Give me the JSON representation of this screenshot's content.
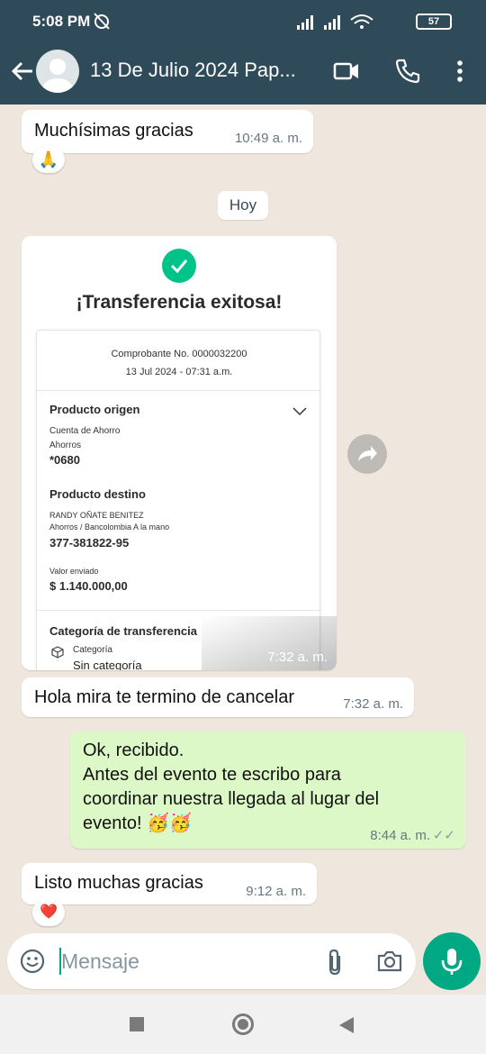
{
  "status_bar": {
    "time": "5:08 PM",
    "battery": "57"
  },
  "header": {
    "title": "13 De Julio 2024 Pap..."
  },
  "messages": {
    "m1": {
      "text": "Muchísimas gracias",
      "time": "10:49 a. m.",
      "reaction": "🙏"
    },
    "day_chip": "Hoy",
    "receipt": {
      "title": "¡Transferencia exitosa!",
      "voucher": "Comprobante No. 0000032200",
      "date": "13 Jul 2024 - 07:31 a.m.",
      "origin_label": "Producto origen",
      "origin_type": "Cuenta de Ahorro",
      "origin_sub": "Ahorros",
      "origin_number": "*0680",
      "dest_label": "Producto destino",
      "dest_name": "RANDY OÑATE BENITEZ",
      "dest_sub": "Ahorros / Bancolombia A la mano",
      "dest_number": "377-381822-95",
      "amount_label": "Valor enviado",
      "amount": "$ 1.140.000,00",
      "category_label": "Categoría de transferencia",
      "category_sub": "Categoría",
      "category_value": "Sin categoría",
      "time": "7:32 a. m."
    },
    "m2": {
      "text": "Hola mira te termino de cancelar",
      "time": "7:32 a. m."
    },
    "m3": {
      "text": "Ok, recibido.\nAntes del evento te escribo para\ncoordinar nuestra llegada al lugar del\nevento! 🥳🥳",
      "time": "8:44 a. m.",
      "status": "✓✓"
    },
    "m4": {
      "text": "Listo muchas gracias",
      "time": "9:12 a. m.",
      "reaction": "❤️"
    }
  },
  "composer": {
    "placeholder": "Mensaje"
  },
  "colors": {
    "header": "#2f4a58",
    "accent": "#00a884",
    "outgoing": "#dcf8c6",
    "check_green": "#00c389"
  }
}
